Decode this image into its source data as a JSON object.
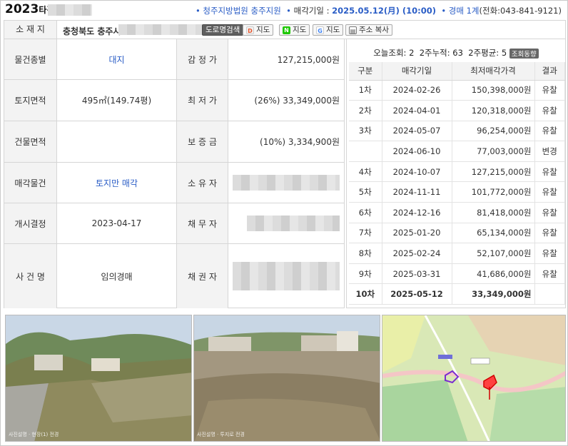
{
  "header": {
    "case_year": "2023",
    "case_suffix": "타경",
    "court_label": "청주지방법원 충주지원",
    "auction_date_label": "매각기일 :",
    "auction_date": "2025.05.12(月) (10:00)",
    "dept_label": "경매 1계",
    "phone": "(전화:043-841-9121)"
  },
  "address": {
    "label": "소 재 지",
    "text": "충청북도 충주시",
    "buttons": {
      "road": "도로명검색",
      "daum": "지도",
      "naver": "지도",
      "google": "지도",
      "copy": "주소 복사"
    }
  },
  "info": {
    "rows": [
      {
        "label": "물건종별",
        "value": "대지",
        "label2": "감 정 가",
        "value2": "127,215,000원"
      },
      {
        "label": "토지면적",
        "value": "495㎡(149.74평)",
        "label2": "최 저 가",
        "value2": "(26%) 33,349,000원"
      },
      {
        "label": "건물면적",
        "value": "",
        "label2": "보 증 금",
        "value2": "(10%) 3,334,900원"
      },
      {
        "label": "매각물건",
        "value": "토지만 매각",
        "label2": "소 유 자",
        "value2": ""
      },
      {
        "label": "개시결정",
        "value": "2023-04-17",
        "label2": "채 무 자",
        "value2": ""
      },
      {
        "label": "사 건 명",
        "value": "임의경매",
        "label2": "채 권 자",
        "value2": ""
      }
    ]
  },
  "views": {
    "today_label": "오늘조회:",
    "today": "2",
    "two_week_label": "2주누적:",
    "two_week": "63",
    "avg_label": "2주평균:",
    "avg": "5",
    "button": "조회동향"
  },
  "history": {
    "headers": [
      "구분",
      "매각기일",
      "최저매각가격",
      "결과"
    ],
    "rows": [
      {
        "no": "1차",
        "date": "2024-02-26",
        "price": "150,398,000원",
        "result": "유찰"
      },
      {
        "no": "2차",
        "date": "2024-04-01",
        "price": "120,318,000원",
        "result": "유찰"
      },
      {
        "no": "3차",
        "date": "2024-05-07",
        "price": "96,254,000원",
        "result": "유찰"
      },
      {
        "no": "",
        "date": "2024-06-10",
        "price": "77,003,000원",
        "result": "변경"
      },
      {
        "no": "4차",
        "date": "2024-10-07",
        "price": "127,215,000원",
        "result": "유찰"
      },
      {
        "no": "5차",
        "date": "2024-11-11",
        "price": "101,772,000원",
        "result": "유찰"
      },
      {
        "no": "6차",
        "date": "2024-12-16",
        "price": "81,418,000원",
        "result": "유찰"
      },
      {
        "no": "7차",
        "date": "2025-01-20",
        "price": "65,134,000원",
        "result": "유찰"
      },
      {
        "no": "8차",
        "date": "2025-02-24",
        "price": "52,107,000원",
        "result": "유찰"
      },
      {
        "no": "9차",
        "date": "2025-03-31",
        "price": "41,686,000원",
        "result": "유찰"
      },
      {
        "no": "10차",
        "date": "2025-05-12",
        "price": "33,349,000원",
        "result": ""
      }
    ]
  },
  "photos": {
    "caption1": "사진설명 · 현장(1) 전경",
    "caption2": "사진설명 · 투지로 전경"
  }
}
